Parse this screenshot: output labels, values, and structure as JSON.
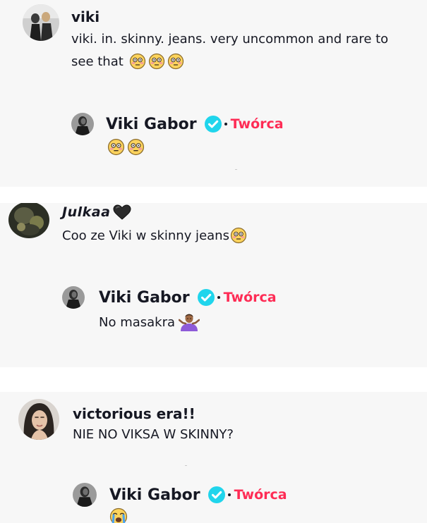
{
  "comments": [
    {
      "author": "viki",
      "text_line1": "viki. in. skinny. jeans. very uncommon and rare to",
      "text_line2": "see that",
      "reply": {
        "author": "Viki Gabor",
        "role": "Twórca",
        "text": ""
      }
    },
    {
      "author": "Julkaa",
      "text": "Coo ze Viki w skinny jeans",
      "reply": {
        "author": "Viki Gabor",
        "role": "Twórca",
        "text": "No masakra"
      }
    },
    {
      "author": "victorious era!!",
      "text": "NIE NO VIKSA W SKINNY?",
      "reply": {
        "author": "Viki Gabor",
        "role": "Twórca",
        "text": ""
      }
    }
  ],
  "icons": {
    "flushed_face": "flushed-face-emoji",
    "black_heart": "black-heart-emoji",
    "shrug": "person-shrugging-emoji",
    "crying_face": "loudly-crying-face-emoji",
    "verified": "verified-badge-icon"
  },
  "colors": {
    "creator_label": "#fe2c55",
    "verified_badge": "#20d5ec",
    "card_background": "#f7f7f7",
    "text": "#161823"
  }
}
